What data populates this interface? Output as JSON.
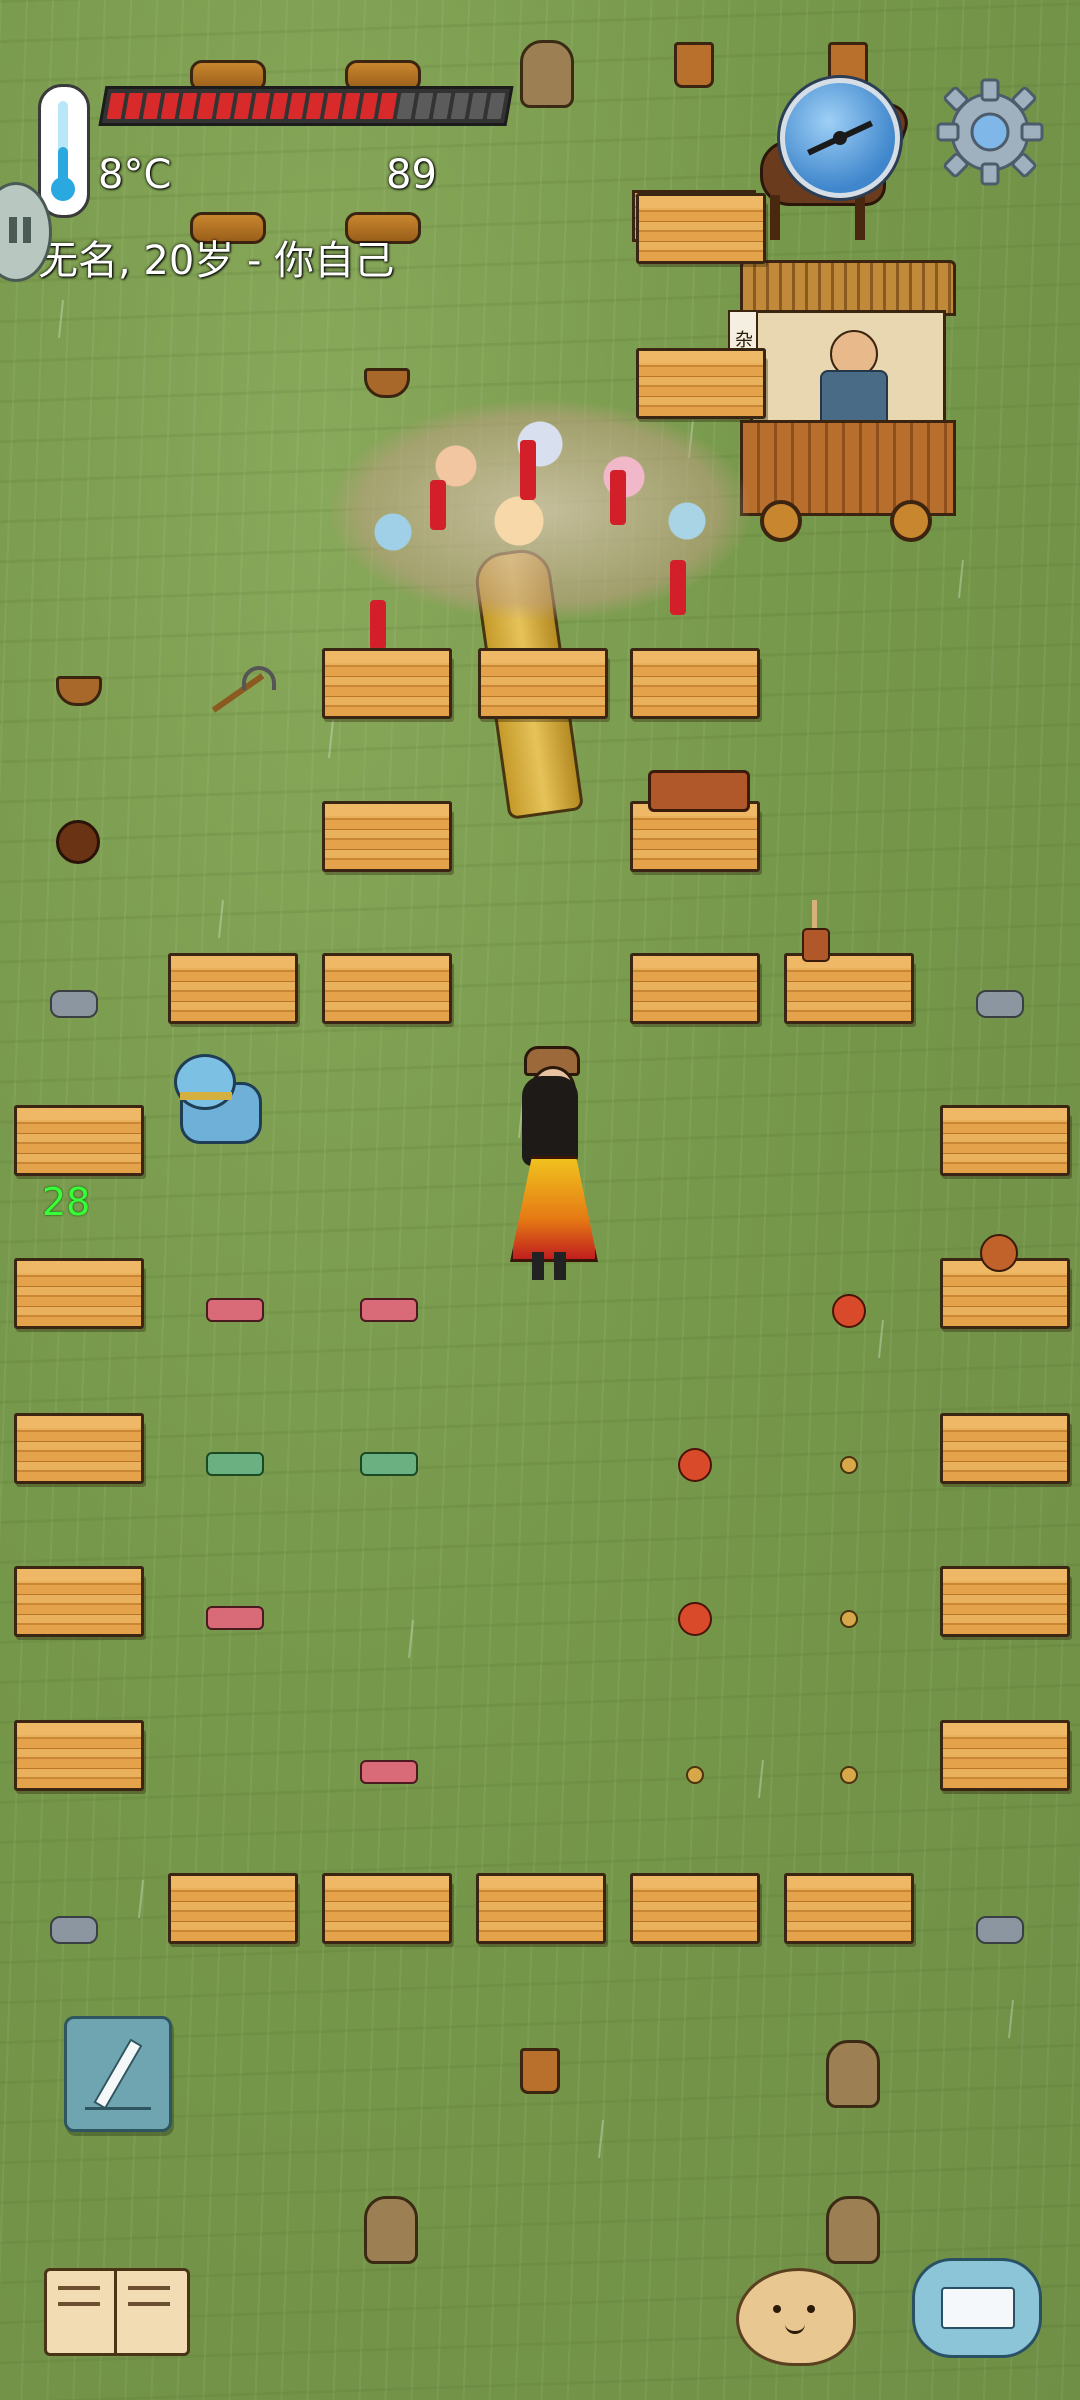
{
  "hud": {
    "temperature": "8°C",
    "food_value": "89",
    "health_fraction": 0.73,
    "player_label": "无名, 20岁 - 你自己"
  },
  "overlay": {
    "hp_number": "28"
  },
  "shop": {
    "sign_text": "杂货铺"
  },
  "icons": {
    "thermometer": "thermometer-icon",
    "compass": "compass-icon",
    "settings": "gear-icon",
    "mute": "mute-icon",
    "note": "pencil-icon",
    "recipes": "book-icon",
    "emote": "emote-potato-icon",
    "keyboard": "keyboard-icon"
  },
  "colors": {
    "grass": "#7a9a4c",
    "health_red": "#d82a2a",
    "hp_green": "#36ff36",
    "crate": "#e4a24a"
  }
}
